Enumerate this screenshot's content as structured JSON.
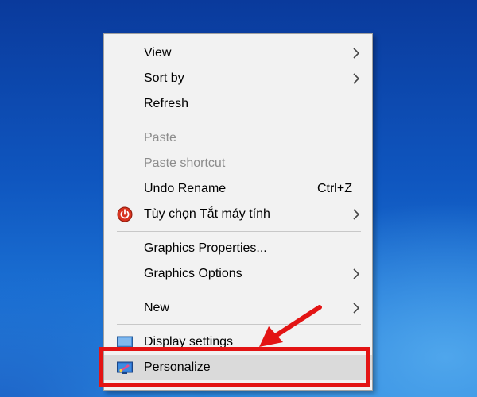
{
  "menu": {
    "items": [
      {
        "label": "View",
        "submenu": true,
        "disabled": false
      },
      {
        "label": "Sort by",
        "submenu": true,
        "disabled": false
      },
      {
        "label": "Refresh",
        "submenu": false,
        "disabled": false
      },
      {
        "label": "Paste",
        "submenu": false,
        "disabled": true
      },
      {
        "label": "Paste shortcut",
        "submenu": false,
        "disabled": true
      },
      {
        "label": "Undo Rename",
        "shortcut": "Ctrl+Z",
        "submenu": false,
        "disabled": false
      },
      {
        "label": "Tùy chọn Tắt máy tính",
        "submenu": true,
        "disabled": false,
        "icon": "power-icon"
      },
      {
        "label": "Graphics Properties...",
        "submenu": false,
        "disabled": false
      },
      {
        "label": "Graphics Options",
        "submenu": true,
        "disabled": false
      },
      {
        "label": "New",
        "submenu": true,
        "disabled": false
      },
      {
        "label": "Display settings",
        "submenu": false,
        "disabled": false,
        "icon": "display-icon"
      },
      {
        "label": "Personalize",
        "submenu": false,
        "disabled": false,
        "icon": "personalize-icon",
        "highlighted": true
      }
    ]
  },
  "colors": {
    "annotation": "#e31414",
    "menu_background": "#f2f2f2",
    "disabled_text": "#8c8c8c",
    "highlight": "#dadada"
  }
}
